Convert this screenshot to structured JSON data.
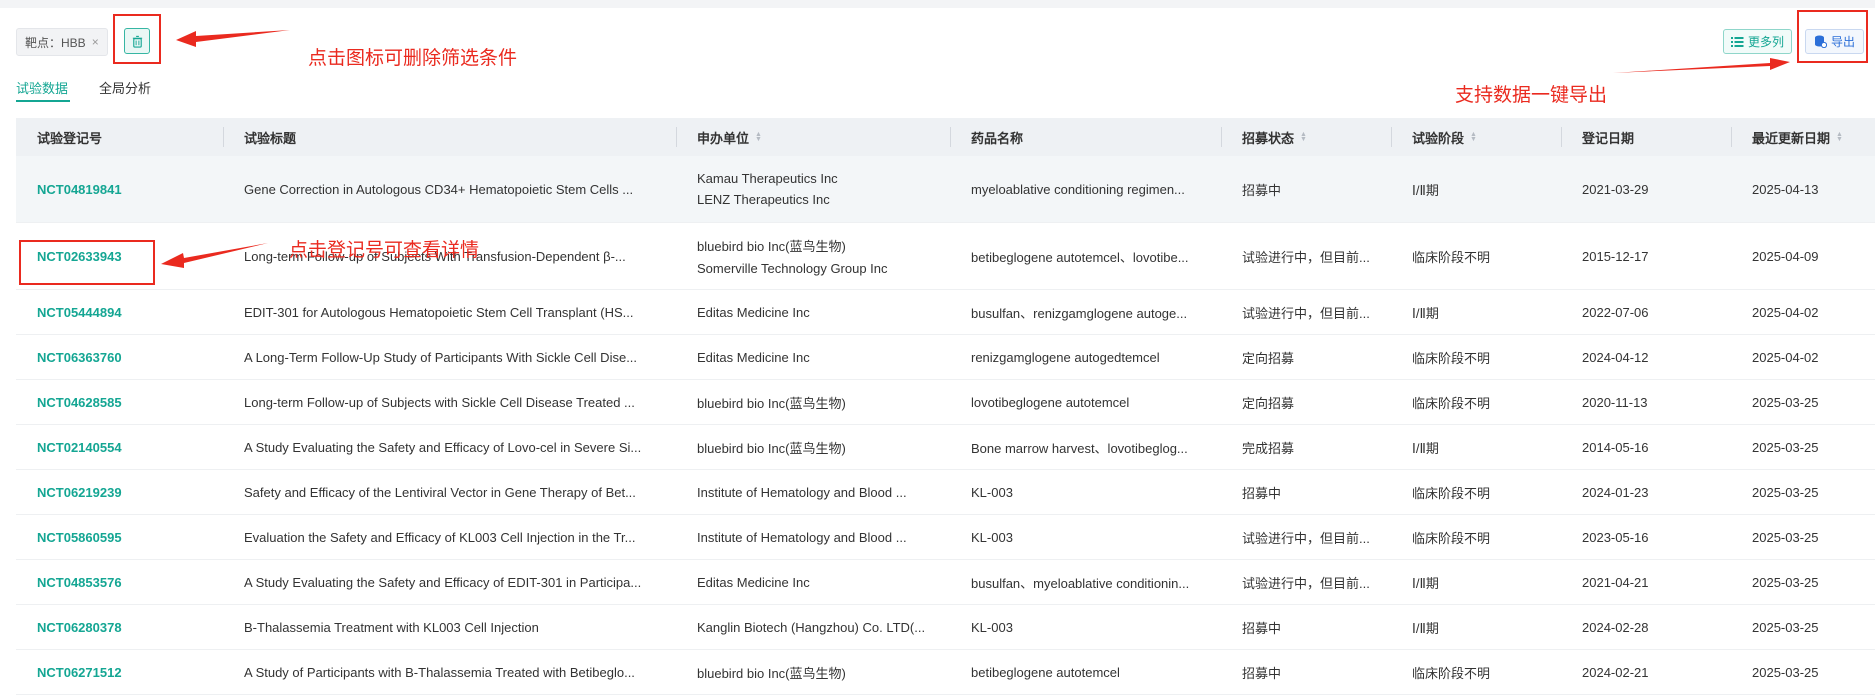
{
  "filter": {
    "tag_label": "靶点：HBB",
    "close_glyph": "×"
  },
  "tabs": [
    {
      "label": "试验数据"
    },
    {
      "label": "全局分析"
    }
  ],
  "toolbar": {
    "more_columns": "更多列",
    "export": "导出"
  },
  "annotations": {
    "delete_filter": "点击图标可删除筛选条件",
    "export_tip": "支持数据一键导出",
    "view_detail": "点击登记号可查看详情"
  },
  "colors": {
    "accent": "#14a693",
    "annotation": "#ea2a1f",
    "export": "#2c6fd8"
  },
  "table": {
    "headers": [
      "试验登记号",
      "试验标题",
      "申办单位",
      "药品名称",
      "招募状态",
      "试验阶段",
      "登记日期",
      "最近更新日期"
    ],
    "rows": [
      {
        "id": "NCT04819841",
        "title": "Gene Correction in Autologous CD34+ Hematopoietic Stem Cells ...",
        "sponsor": [
          "Kamau Therapeutics Inc",
          "LENZ Therapeutics Inc"
        ],
        "drug": "myeloablative conditioning regimen...",
        "status": "招募中",
        "phase": "Ⅰ/Ⅱ期",
        "reg_date": "2021-03-29",
        "update_date": "2025-04-13"
      },
      {
        "id": "NCT02633943",
        "title": "Long-term Follow-up of Subjects With Transfusion-Dependent β-...",
        "sponsor": [
          "bluebird bio Inc(蓝鸟生物)",
          "Somerville Technology Group Inc"
        ],
        "drug": "betibeglogene autotemcel、lovotibe...",
        "status": "试验进行中，但目前...",
        "phase": "临床阶段不明",
        "reg_date": "2015-12-17",
        "update_date": "2025-04-09"
      },
      {
        "id": "NCT05444894",
        "title": "EDIT-301 for Autologous Hematopoietic Stem Cell Transplant (HS...",
        "sponsor": [
          "Editas Medicine Inc"
        ],
        "drug": "busulfan、renizgamglogene autoge...",
        "status": "试验进行中，但目前...",
        "phase": "Ⅰ/Ⅱ期",
        "reg_date": "2022-07-06",
        "update_date": "2025-04-02"
      },
      {
        "id": "NCT06363760",
        "title": "A Long-Term Follow-Up Study of Participants With Sickle Cell Dise...",
        "sponsor": [
          "Editas Medicine Inc"
        ],
        "drug": "renizgamglogene autogedtemcel",
        "status": "定向招募",
        "phase": "临床阶段不明",
        "reg_date": "2024-04-12",
        "update_date": "2025-04-02"
      },
      {
        "id": "NCT04628585",
        "title": "Long-term Follow-up of Subjects with Sickle Cell Disease Treated ...",
        "sponsor": [
          "bluebird bio Inc(蓝鸟生物)"
        ],
        "drug": "lovotibeglogene autotemcel",
        "status": "定向招募",
        "phase": "临床阶段不明",
        "reg_date": "2020-11-13",
        "update_date": "2025-03-25"
      },
      {
        "id": "NCT02140554",
        "title": "A Study Evaluating the Safety and Efficacy of Lovo-cel in Severe Si...",
        "sponsor": [
          "bluebird bio Inc(蓝鸟生物)"
        ],
        "drug": "Bone marrow harvest、lovotibeglog...",
        "status": "完成招募",
        "phase": "Ⅰ/Ⅱ期",
        "reg_date": "2014-05-16",
        "update_date": "2025-03-25"
      },
      {
        "id": "NCT06219239",
        "title": "Safety and Efficacy of the Lentiviral Vector in Gene Therapy of Bet...",
        "sponsor": [
          "Institute of Hematology and Blood ..."
        ],
        "drug": "KL-003",
        "status": "招募中",
        "phase": "临床阶段不明",
        "reg_date": "2024-01-23",
        "update_date": "2025-03-25"
      },
      {
        "id": "NCT05860595",
        "title": "Evaluation the Safety and Efficacy of KL003 Cell Injection in the Tr...",
        "sponsor": [
          "Institute of Hematology and Blood ..."
        ],
        "drug": "KL-003",
        "status": "试验进行中，但目前...",
        "phase": "临床阶段不明",
        "reg_date": "2023-05-16",
        "update_date": "2025-03-25"
      },
      {
        "id": "NCT04853576",
        "title": "A Study Evaluating the Safety and Efficacy of EDIT-301 in Participa...",
        "sponsor": [
          "Editas Medicine Inc"
        ],
        "drug": "busulfan、myeloablative conditionin...",
        "status": "试验进行中，但目前...",
        "phase": "Ⅰ/Ⅱ期",
        "reg_date": "2021-04-21",
        "update_date": "2025-03-25"
      },
      {
        "id": "NCT06280378",
        "title": "B-Thalassemia Treatment with KL003 Cell Injection",
        "sponsor": [
          "Kanglin Biotech (Hangzhou) Co. LTD(..."
        ],
        "drug": "KL-003",
        "status": "招募中",
        "phase": "Ⅰ/Ⅱ期",
        "reg_date": "2024-02-28",
        "update_date": "2025-03-25"
      },
      {
        "id": "NCT06271512",
        "title": "A Study of Participants with B-Thalassemia Treated with Betibeglo...",
        "sponsor": [
          "bluebird bio Inc(蓝鸟生物)"
        ],
        "drug": "betibeglogene autotemcel",
        "status": "招募中",
        "phase": "临床阶段不明",
        "reg_date": "2024-02-21",
        "update_date": "2025-03-25"
      }
    ]
  }
}
